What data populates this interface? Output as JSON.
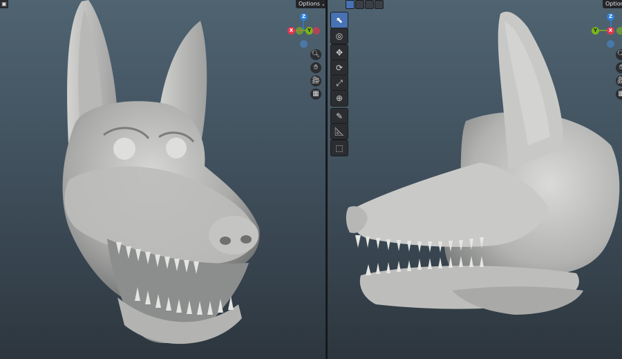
{
  "viewports": {
    "left": {
      "options_label": "Options",
      "options_chevron": "⌄"
    },
    "right": {
      "options_label": "Options",
      "options_chevron": "⌄"
    }
  },
  "gizmo": {
    "x": "X",
    "y": "Y",
    "z": "Z"
  },
  "icons": {
    "zoom": "🔍︎",
    "pan": "✋︎",
    "camera": "🎥︎",
    "grid": "▦",
    "select_box": "⬉",
    "cursor": "◎",
    "move": "✥",
    "rotate": "⟳",
    "scale": "⤢",
    "transform": "⊕",
    "annotate": "✎",
    "measure": "📐︎",
    "add_cube": "⬚",
    "mode": "▣"
  },
  "colors": {
    "axis_x": "#e2374d",
    "axis_y": "#7ab51d",
    "axis_z": "#2f7fd7",
    "active_tool": "#4772b3"
  }
}
